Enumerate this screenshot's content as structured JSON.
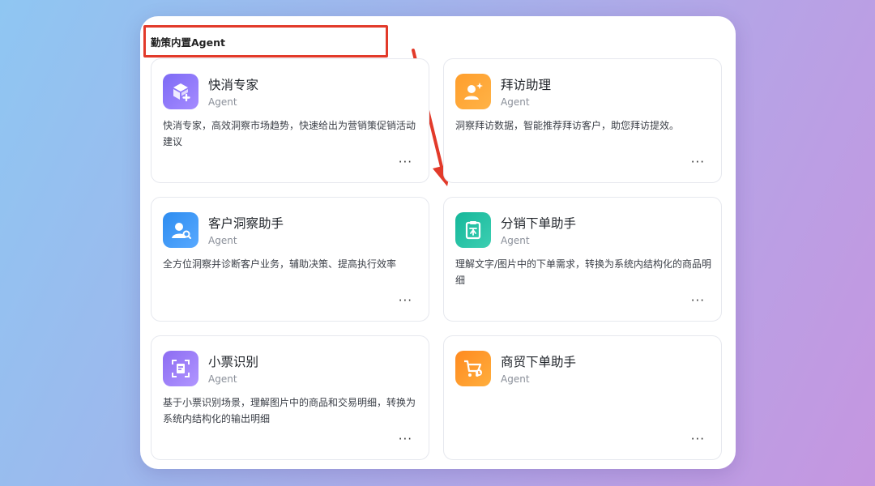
{
  "section": {
    "title": "勤策内置Agent"
  },
  "agents": [
    {
      "name": "快消专家",
      "tag": "Agent",
      "desc": "快消专家，高效洞察市场趋势，快速给出为营销策促销活动建议",
      "icon": "cube-plus-icon",
      "more": "···"
    },
    {
      "name": "拜访助理",
      "tag": "Agent",
      "desc": "洞察拜访数据，智能推荐拜访客户，助您拜访提效。",
      "icon": "user-sparkle-icon",
      "more": "···"
    },
    {
      "name": "客户洞察助手",
      "tag": "Agent",
      "desc": "全方位洞察并诊断客户业务，辅助决策、提高执行效率",
      "icon": "user-search-icon",
      "more": "···"
    },
    {
      "name": "分销下单助手",
      "tag": "Agent",
      "desc": "理解文字/图片中的下单需求，转换为系统内结构化的商品明细",
      "icon": "clipboard-order-icon",
      "more": "···"
    },
    {
      "name": "小票识别",
      "tag": "Agent",
      "desc": "基于小票识别场景，理解图片中的商品和交易明细，转换为系统内结构化的输出明细",
      "icon": "receipt-scan-icon",
      "more": "···"
    },
    {
      "name": "商贸下单助手",
      "tag": "Agent",
      "desc": "",
      "icon": "cart-icon",
      "more": "···"
    }
  ],
  "colors": {
    "highlight": "#e23a2a",
    "panel": "#ffffff"
  }
}
